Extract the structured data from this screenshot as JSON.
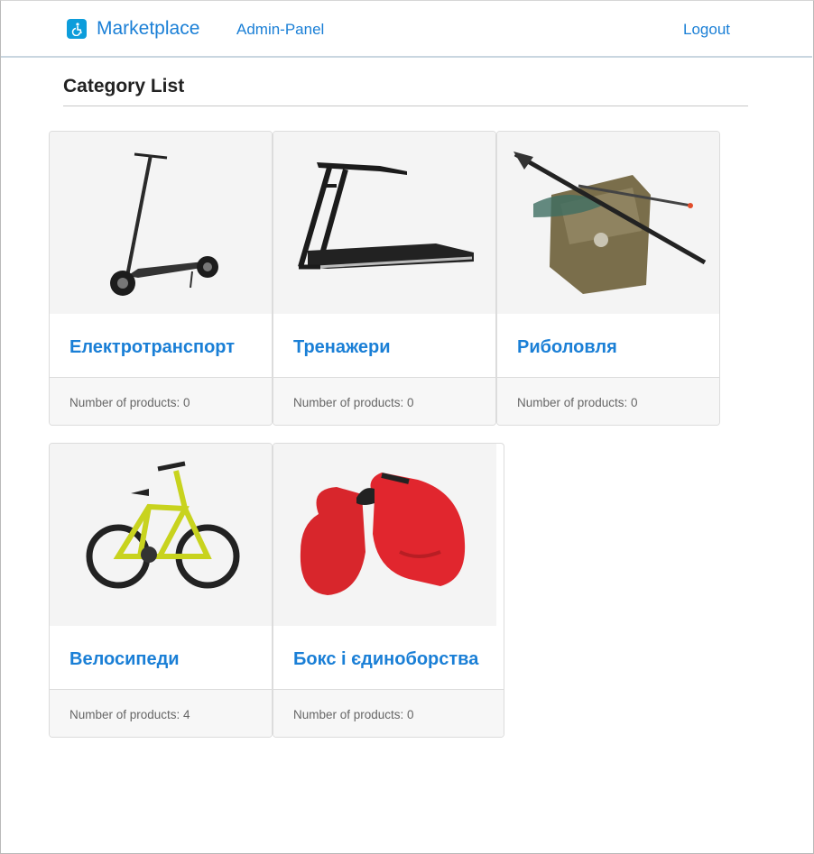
{
  "header": {
    "brand": "Marketplace",
    "brand_icon": "wheelchair-icon",
    "admin_label": "Admin-Panel",
    "logout_label": "Logout",
    "accent": "#1a7fd6"
  },
  "page": {
    "title": "Category List"
  },
  "categories": [
    {
      "name": "Електротранспорт",
      "products_text": "Number of products: 0",
      "image": "electric-scooter"
    },
    {
      "name": "Тренажери",
      "products_text": "Number of products: 0",
      "image": "treadmill"
    },
    {
      "name": "Риболовля",
      "products_text": "Number of products: 0",
      "image": "fishing-gear"
    },
    {
      "name": "Велосипеди",
      "products_text": "Number of products: 4",
      "image": "bicycle"
    },
    {
      "name": "Бокс і єдиноборства",
      "products_text": "Number of products: 0",
      "image": "boxing-gloves"
    }
  ]
}
